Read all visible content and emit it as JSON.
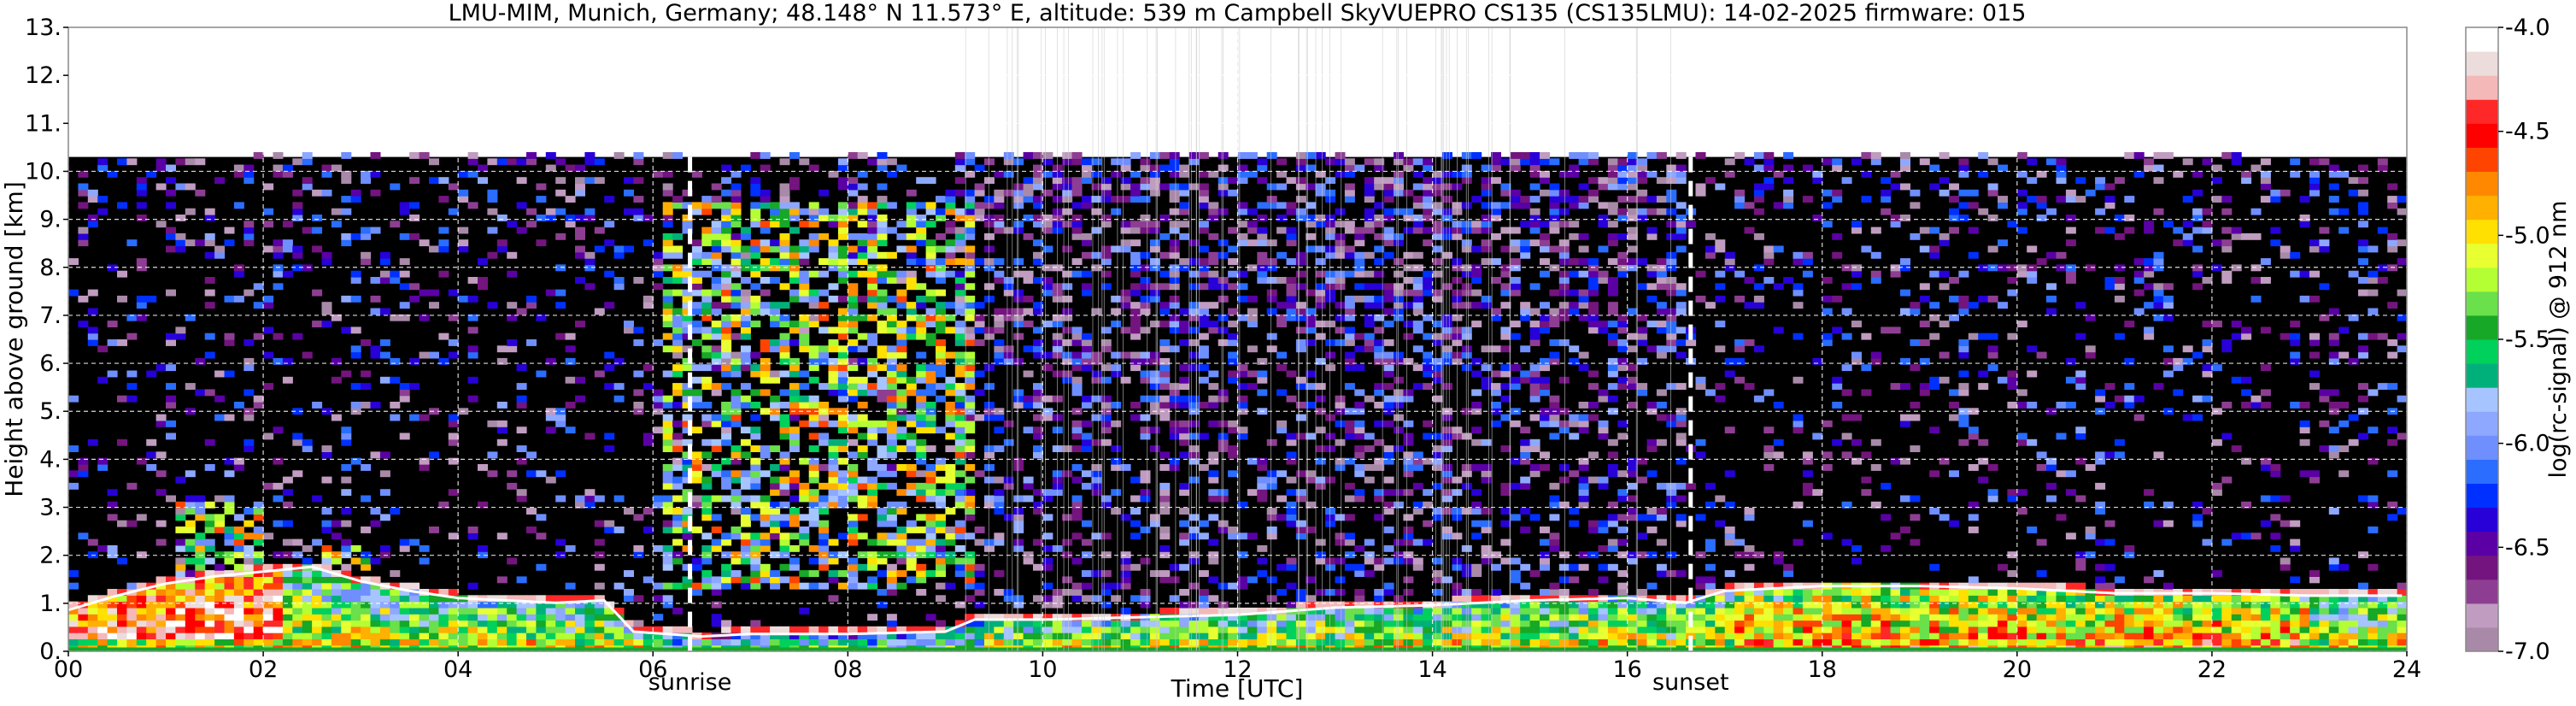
{
  "chart_data": {
    "type": "heatmap",
    "title": "LMU-MIM, Munich, Germany; 48.148° N 11.573° E, altitude: 539 m    Campbell SkyVUEPRO CS135 (CS135LMU): 14-02-2025    firmware: 015",
    "xlabel": "Time [UTC]",
    "ylabel": "Height above ground [km]",
    "colorbar_label": "log(rc-signal) @ 912 nm",
    "xlim": [
      0,
      24
    ],
    "ylim": [
      0,
      13
    ],
    "x_ticks": [
      "00",
      "02",
      "04",
      "06",
      "08",
      "10",
      "12",
      "14",
      "16",
      "18",
      "20",
      "22",
      "24"
    ],
    "y_ticks": [
      "0.",
      "1.",
      "2.",
      "3.",
      "4.",
      "5.",
      "6.",
      "7.",
      "8.",
      "9.",
      "10.",
      "11.",
      "12.",
      "13."
    ],
    "colorbar_range": [
      -7.0,
      -4.0
    ],
    "colorbar_ticks": [
      "-4.0",
      "-4.5",
      "-5.0",
      "-5.5",
      "-6.0",
      "-6.5",
      "-7.0"
    ],
    "colormap": [
      "#a88aa8",
      "#c09cc0",
      "#8e3e92",
      "#73147f",
      "#5a00a5",
      "#2800d8",
      "#0030ff",
      "#2a6dff",
      "#6f8fff",
      "#8ea8ff",
      "#a6c4ff",
      "#00b07a",
      "#00d05c",
      "#16a826",
      "#6ae04a",
      "#b4ff34",
      "#e8ff32",
      "#ffe000",
      "#ffb000",
      "#ff8800",
      "#ff4400",
      "#ff0000",
      "#ff2828",
      "#f4b8b8",
      "#ecdcdc",
      "#ffffff"
    ],
    "grid": true,
    "data_top_km": 10.3,
    "annotations": [
      {
        "label": "sunrise",
        "time_utc": 6.38
      },
      {
        "label": "sunset",
        "time_utc": 16.65
      }
    ],
    "boundary_layer": [
      {
        "t": 0.0,
        "h": 0.8
      },
      {
        "t": 0.5,
        "h": 1.1
      },
      {
        "t": 1.0,
        "h": 1.35
      },
      {
        "t": 1.5,
        "h": 1.5
      },
      {
        "t": 2.0,
        "h": 1.6
      },
      {
        "t": 2.5,
        "h": 1.7
      },
      {
        "t": 3.0,
        "h": 1.4
      },
      {
        "t": 3.5,
        "h": 1.2
      },
      {
        "t": 4.0,
        "h": 1.05
      },
      {
        "t": 4.5,
        "h": 1.0
      },
      {
        "t": 5.0,
        "h": 0.95
      },
      {
        "t": 5.5,
        "h": 1.0
      },
      {
        "t": 5.8,
        "h": 0.35
      },
      {
        "t": 6.5,
        "h": 0.25
      },
      {
        "t": 7.0,
        "h": 0.3
      },
      {
        "t": 8.0,
        "h": 0.3
      },
      {
        "t": 9.0,
        "h": 0.35
      },
      {
        "t": 9.3,
        "h": 0.6
      },
      {
        "t": 10.0,
        "h": 0.6
      },
      {
        "t": 11.0,
        "h": 0.65
      },
      {
        "t": 12.0,
        "h": 0.7
      },
      {
        "t": 13.0,
        "h": 0.85
      },
      {
        "t": 14.0,
        "h": 0.9
      },
      {
        "t": 15.0,
        "h": 1.0
      },
      {
        "t": 16.0,
        "h": 1.05
      },
      {
        "t": 16.6,
        "h": 0.95
      },
      {
        "t": 17.0,
        "h": 1.2
      },
      {
        "t": 18.0,
        "h": 1.3
      },
      {
        "t": 19.0,
        "h": 1.3
      },
      {
        "t": 20.0,
        "h": 1.25
      },
      {
        "t": 21.0,
        "h": 1.15
      },
      {
        "t": 22.0,
        "h": 1.15
      },
      {
        "t": 23.0,
        "h": 1.1
      },
      {
        "t": 24.0,
        "h": 1.1
      }
    ],
    "elevated_aerosol_layers": [
      {
        "t_start": 1.0,
        "t_end": 2.0,
        "base_km": 1.5,
        "top_km": 3.1
      },
      {
        "t_start": 2.6,
        "t_end": 3.1,
        "base_km": 1.2,
        "top_km": 2.2
      },
      {
        "t_start": 6.0,
        "t_end": 9.2,
        "base_km": 1.2,
        "top_km": 9.3
      }
    ]
  }
}
